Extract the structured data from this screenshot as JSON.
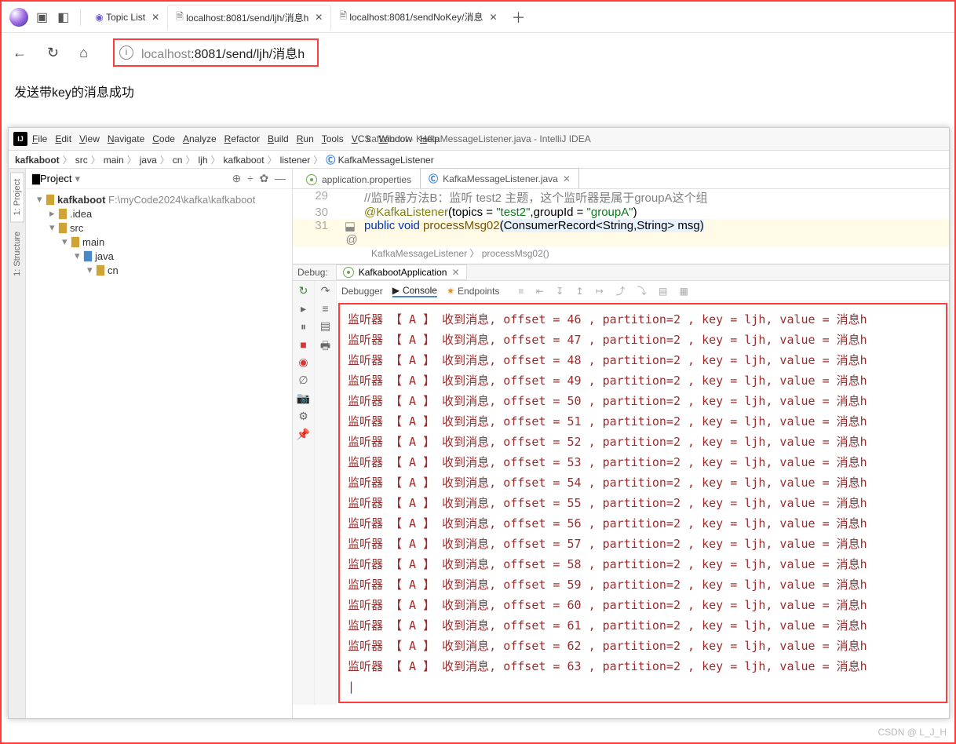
{
  "browser": {
    "tabs": [
      {
        "label": "Topic List"
      },
      {
        "label": "localhost:8081/send/ljh/消息h"
      },
      {
        "label": "localhost:8081/sendNoKey/消息"
      }
    ],
    "url_host": "localhost",
    "url_port_path": ":8081/send/ljh/消息h",
    "page_text": "发送带key的消息成功"
  },
  "ide": {
    "title": "kafkaboot - KafkaMessageListener.java - IntelliJ IDEA",
    "menu": [
      "File",
      "Edit",
      "View",
      "Navigate",
      "Code",
      "Analyze",
      "Refactor",
      "Build",
      "Run",
      "Tools",
      "VCS",
      "Window",
      "Help"
    ],
    "crumbs": [
      "kafkaboot",
      "src",
      "main",
      "java",
      "cn",
      "ljh",
      "kafkaboot",
      "listener",
      "KafkaMessageListener"
    ],
    "project": {
      "label": "Project",
      "root": "kafkaboot",
      "root_path": "F:\\myCode2024\\kafka\\kafkaboot",
      "nodes": [
        ".idea",
        "src",
        "main",
        "java",
        "cn"
      ]
    },
    "editor": {
      "tabs": [
        "application.properties",
        "KafkaMessageListener.java"
      ],
      "ln29": "29",
      "ln30": "30",
      "ln31": "31",
      "comment": "//监听器方法B：监听 test2 主题，这个监听器是属于groupA这个组",
      "ann": "@KafkaListener",
      "ann_args": "(topics = \"test2\",groupId = \"groupA\")",
      "sig_pre": "public void ",
      "sig_fn": "processMsg02",
      "sig_args": "(ConsumerRecord<String,String> msg)",
      "sub_crumbs": "KafkaMessageListener 〉 processMsg02()"
    },
    "debug": {
      "label": "Debug:",
      "app": "KafkabootApplication",
      "tabs": [
        "Debugger",
        "Console",
        "Endpoints"
      ],
      "console_prefix": "监听器 【 A 】 收到消息, offset = ",
      "console_mid": " , partition=2 , key = ljh, value = 消息h",
      "offsets": [
        46,
        47,
        48,
        49,
        50,
        51,
        52,
        53,
        54,
        55,
        56,
        57,
        58,
        59,
        60,
        61,
        62,
        63
      ]
    }
  },
  "watermark": "CSDN @ L_J_H"
}
